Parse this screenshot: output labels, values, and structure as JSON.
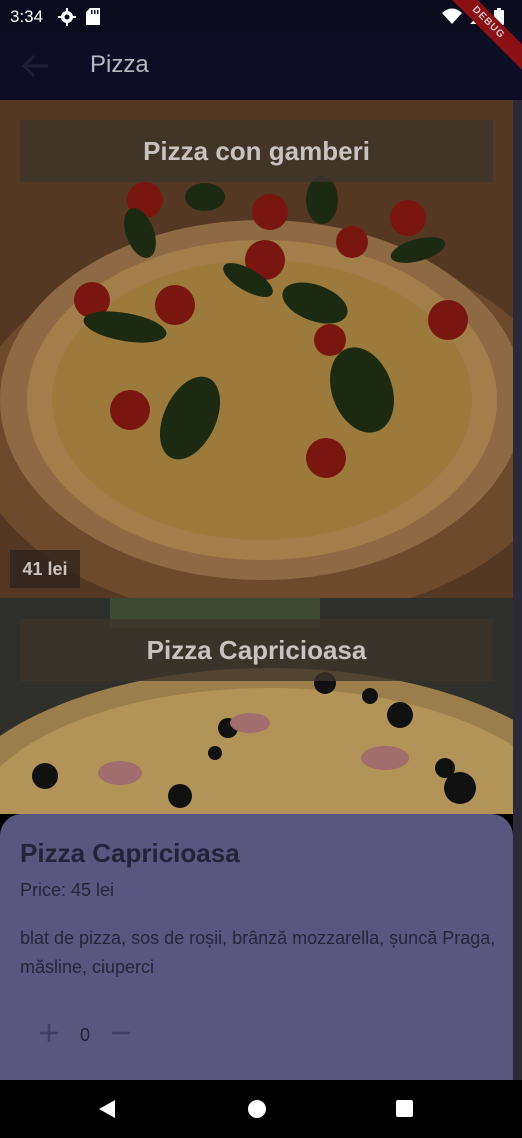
{
  "status": {
    "time": "3:34"
  },
  "debug_label": "DEBUG",
  "app_bar": {
    "title": "Pizza"
  },
  "pizzas": [
    {
      "name": "Pizza con gamberi",
      "price_label": "41 lei"
    },
    {
      "name": "Pizza Capricioasa"
    }
  ],
  "sheet": {
    "name": "Pizza Capricioasa",
    "price": "Price: 45 lei",
    "description": "blat de pizza, sos de roșii, brânză mozzarella, șuncă Praga, măsline, ciuperci",
    "quantity": "0"
  },
  "colors": {
    "app_bar": "#0d0e26",
    "sheet": "#59577f",
    "debug_ribbon": "#8b1016"
  }
}
